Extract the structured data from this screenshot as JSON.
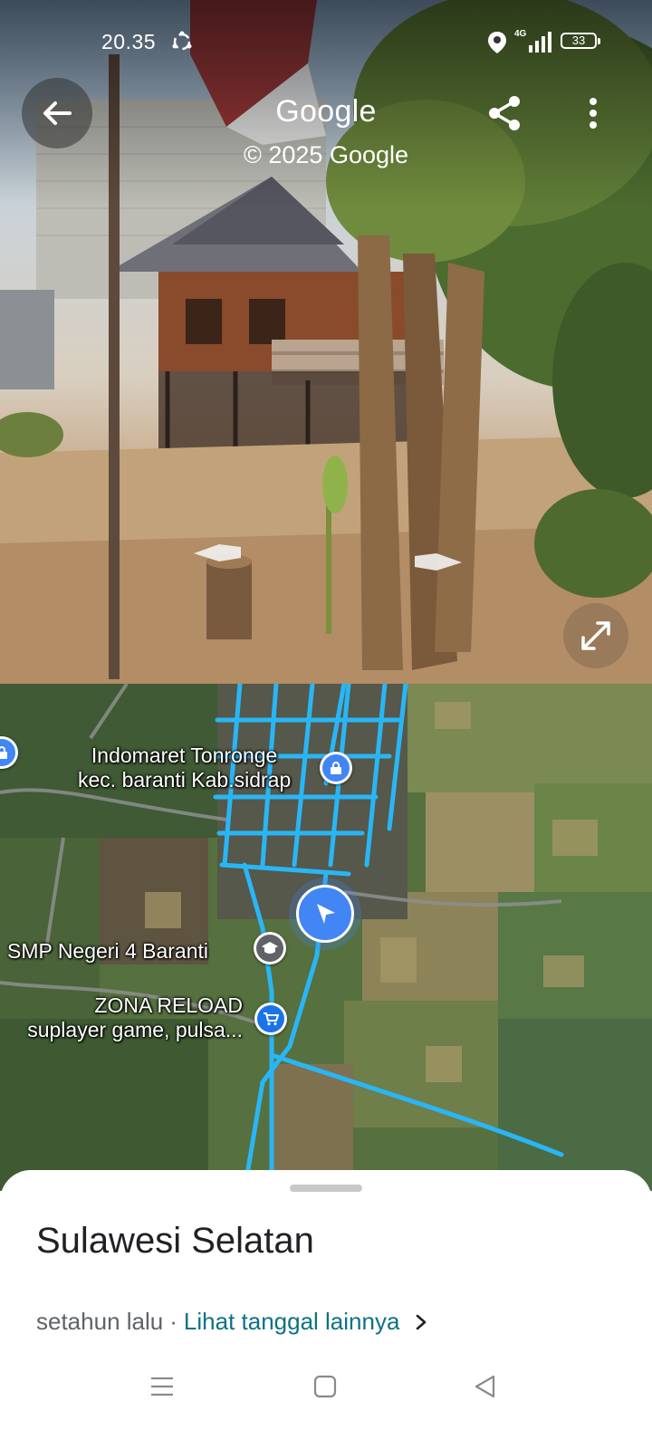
{
  "status_bar": {
    "time": "20.35",
    "network": "4G",
    "battery": "33",
    "icons": [
      "sync-icon",
      "location-icon",
      "signal-icon",
      "battery-icon"
    ]
  },
  "street_view": {
    "title": "Google",
    "copyright": "© 2025 Google",
    "icons": [
      "back-arrow-icon",
      "share-icon",
      "more-vert-icon",
      "expand-icon",
      "nav-arrow-left-icon",
      "nav-arrow-right-icon"
    ]
  },
  "map": {
    "places": [
      {
        "name": "Indomaret Tonronge",
        "subtitle": "kec. baranti Kab.sidrap",
        "icon": "lock-icon"
      },
      {
        "name": "SMP Negeri 4 Baranti",
        "icon": "school-icon"
      },
      {
        "name": "ZONA RELOAD",
        "subtitle": "suplayer game, pulsa...",
        "icon": "shopping-cart-icon"
      }
    ],
    "colors": {
      "route": "#29b6f6",
      "location": "#4285f4"
    }
  },
  "sheet": {
    "place_title": "Sulawesi Selatan",
    "date_text": "setahun lalu",
    "separator": "·",
    "date_link": "Lihat tanggal lainnya",
    "link_color": "#0b7285"
  },
  "nav_bar": {
    "icons": [
      "menu-icon",
      "home-icon",
      "back-icon"
    ]
  }
}
